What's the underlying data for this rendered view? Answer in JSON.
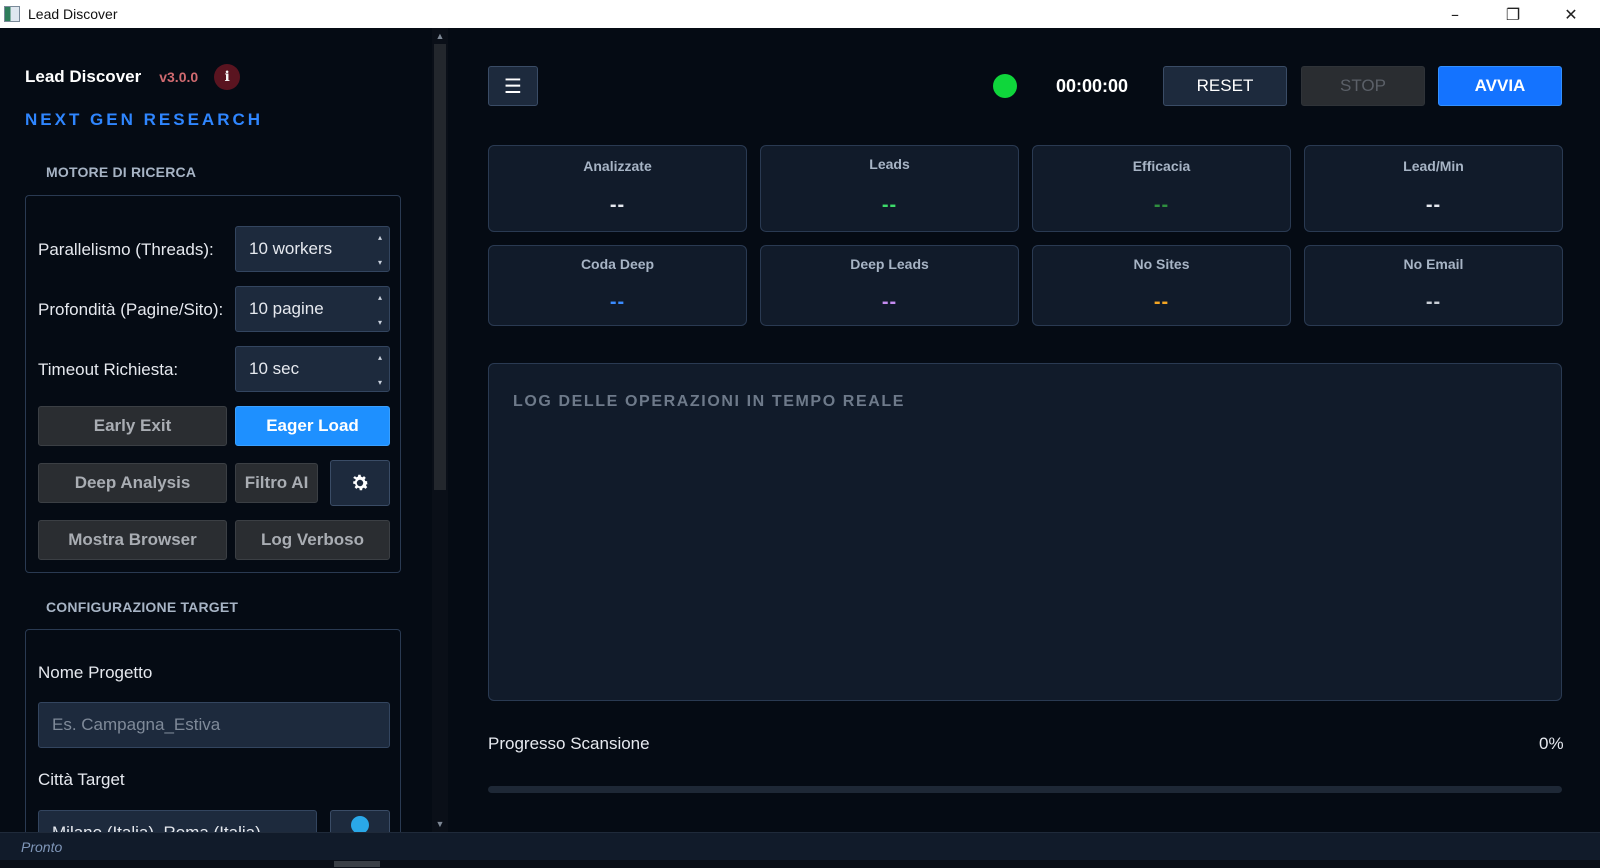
{
  "window": {
    "title": "Lead Discover"
  },
  "sidebar": {
    "brand_name": "Lead Discover",
    "version": "v3.0.0",
    "info_glyph": "i",
    "tagline": "NEXT GEN RESEARCH",
    "engine": {
      "section_title": "MOTORE DI RICERCA",
      "threads_label": "Parallelismo (Threads):",
      "threads_value": "10 workers",
      "depth_label": "Profondità (Pagine/Sito):",
      "depth_value": "10 pagine",
      "timeout_label": "Timeout Richiesta:",
      "timeout_value": "10 sec",
      "early_exit": "Early Exit",
      "eager_load": "Eager Load",
      "deep_analysis": "Deep Analysis",
      "ai_filter": "Filtro AI",
      "show_browser": "Mostra Browser",
      "verbose_log": "Log Verboso"
    },
    "target": {
      "section_title": "CONFIGURAZIONE TARGET",
      "project_label": "Nome Progetto",
      "project_placeholder": "Es. Campagna_Estiva",
      "city_label": "Città Target",
      "city_value": "Milano (Italia), Roma (Italia)"
    }
  },
  "toolbar": {
    "menu_glyph": "☰",
    "timer": "00:00:00",
    "reset": "RESET",
    "stop": "STOP",
    "start": "AVVIA",
    "status_color": "#0fd63b"
  },
  "stats": [
    {
      "label": "Analizzate",
      "value": "--",
      "color": "#e6e9ef"
    },
    {
      "label": "Leads",
      "value": "--",
      "color": "#3ddc6a"
    },
    {
      "label": "Efficacia",
      "value": "--",
      "color": "#2f8f3f"
    },
    {
      "label": "Lead/Min",
      "value": "--",
      "color": "#e6e9ef"
    },
    {
      "label": "Coda Deep",
      "value": "--",
      "color": "#3b8cff"
    },
    {
      "label": "Deep Leads",
      "value": "--",
      "color": "#c58cf0"
    },
    {
      "label": "No Sites",
      "value": "--",
      "color": "#f5a623"
    },
    {
      "label": "No Email",
      "value": "--",
      "color": "#c9ced6"
    }
  ],
  "log": {
    "title": "LOG DELLE OPERAZIONI IN TEMPO REALE"
  },
  "progress": {
    "label": "Progresso Scansione",
    "percent_text": "0%",
    "value": 0
  },
  "statusbar": {
    "text": "Pronto"
  }
}
